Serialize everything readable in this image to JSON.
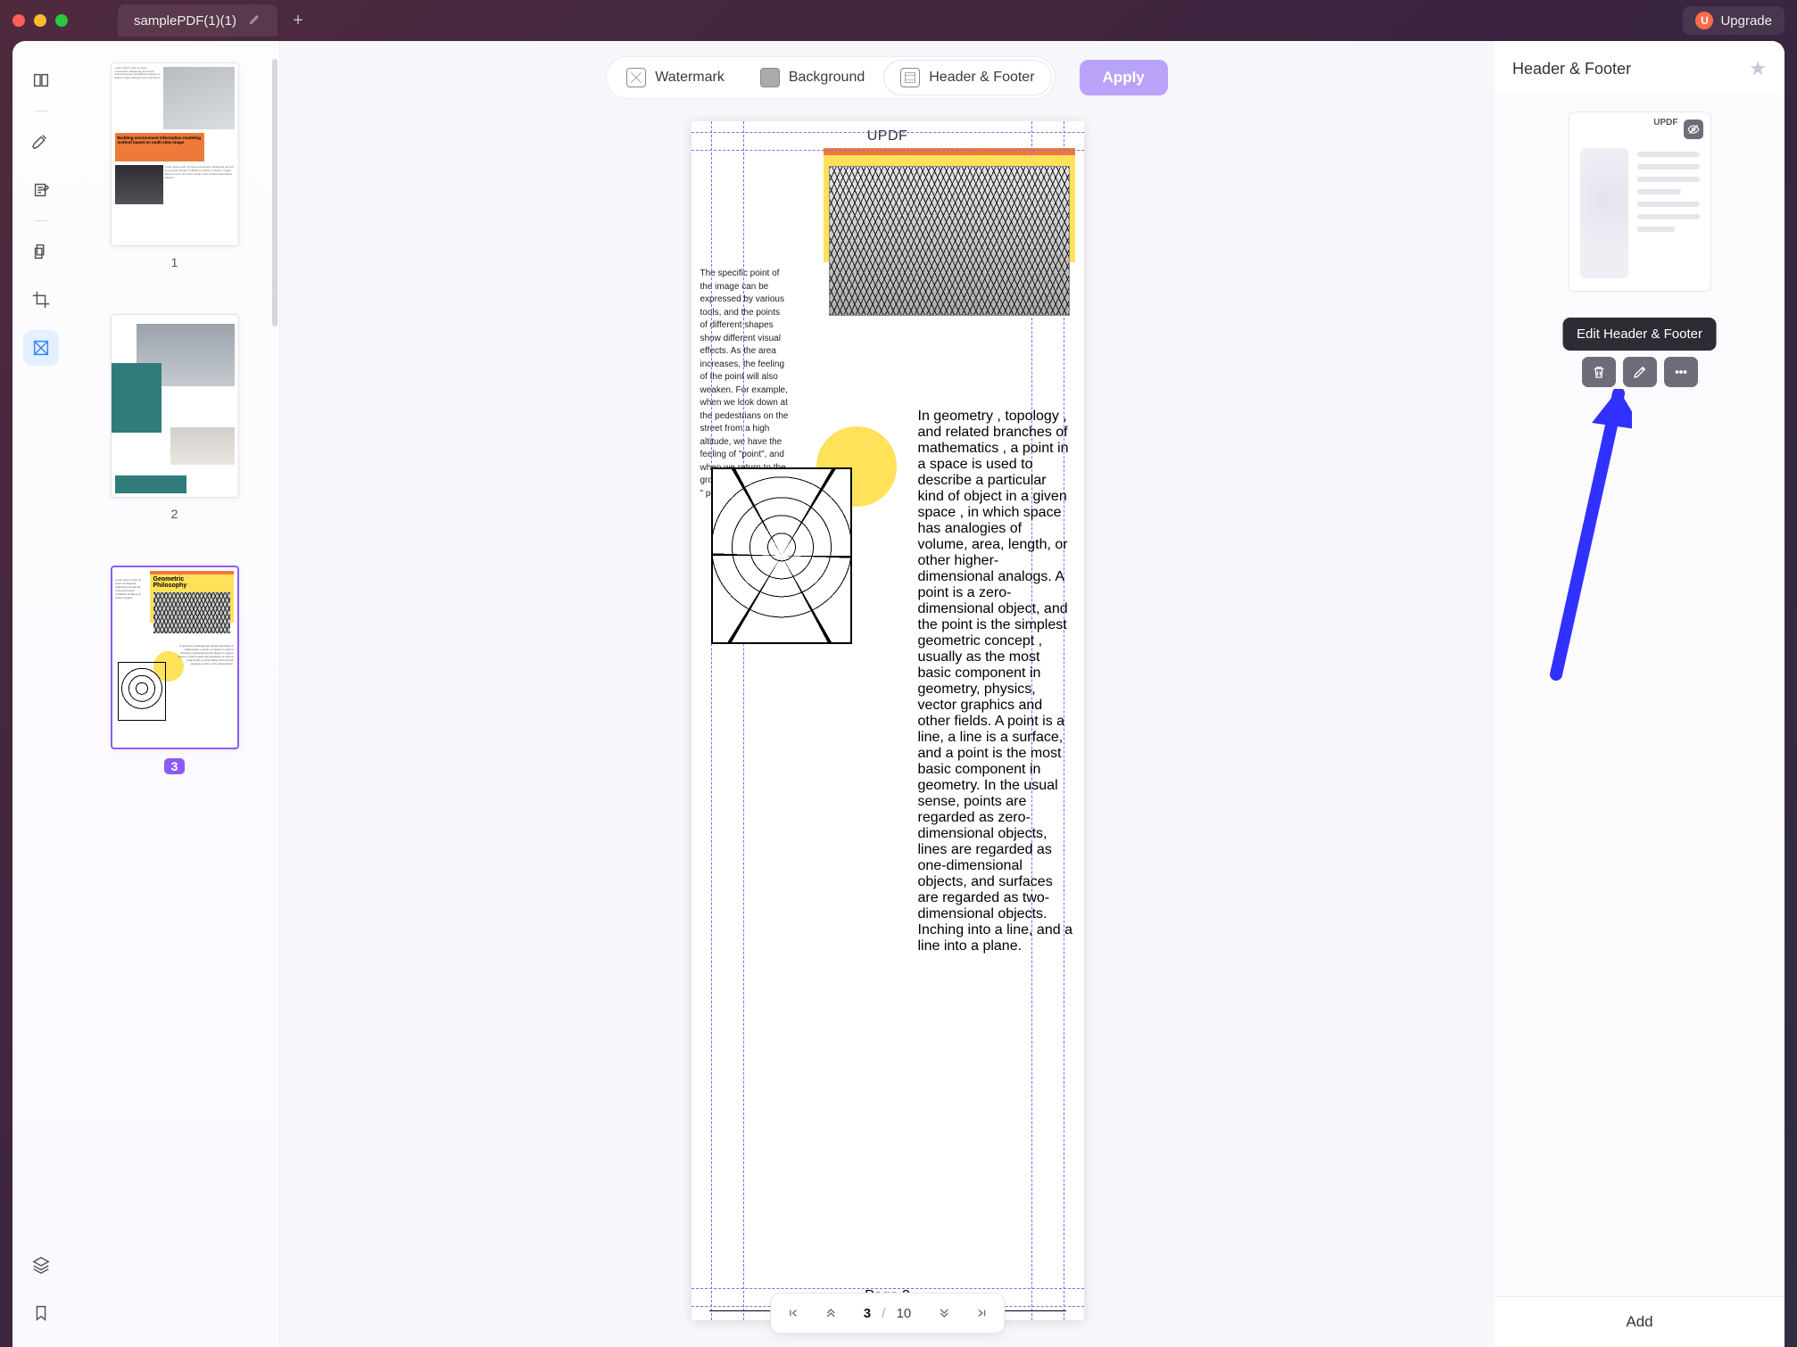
{
  "title_bar": {
    "file_name": "samplePDF(1)(1)",
    "upgrade_label": "Upgrade",
    "upgrade_badge": "U"
  },
  "left_rail": {
    "tools": [
      {
        "name": "reader-mode-icon"
      },
      {
        "name": "highlighter-icon"
      },
      {
        "name": "edit-text-icon"
      },
      {
        "name": "organize-pages-icon"
      },
      {
        "name": "crop-icon"
      },
      {
        "name": "page-tools-icon"
      }
    ]
  },
  "thumbnails": [
    {
      "num": "1",
      "title": "Building environment information modeling method based on multi-view image"
    },
    {
      "num": "2"
    },
    {
      "num": "3",
      "title": "Geometric\nPhilosophy"
    }
  ],
  "toolbar": {
    "watermark": "Watermark",
    "background": "Background",
    "headerfooter": "Header & Footer",
    "apply": "Apply"
  },
  "document": {
    "header_text": "UPDF",
    "heading": "Geometric Philosophy",
    "left_paragraph": "The specific point of the image can be expressed by various tools, and the points of different shapes show different visual effects. As the area increases, the feeling of the point will also weaken. For example, when we look down at the pedestrians on the street from a high altitude, we have the feeling of \"point\", and when we return to the ground, the feeling of \" point\" disappears.",
    "right_paragraph": "In geometry , topology , and related branches of mathematics , a point in a space is used to describe a particular kind of object in a given space , in which space has analogies of volume, area, length, or other higher-dimensional analogs. A point is a zero-dimensional object, and the point is the simplest geometric concept , usually as the most basic component in geometry, physics, vector graphics and other fields. A point is a line, a line is a surface, and a point is the most basic component in geometry. In the usual sense, points are regarded as zero-dimensional objects, lines are regarded as one-dimensional objects, and surfaces are regarded as two-dimensional objects. Inching into a line, and a line into a plane.",
    "footer_text": "Page 3"
  },
  "pager": {
    "current": "3",
    "sep": "/",
    "total": "10"
  },
  "right_panel": {
    "title": "Header & Footer",
    "preset_label": "UPDF",
    "tooltip": "Edit Header & Footer",
    "add": "Add"
  }
}
